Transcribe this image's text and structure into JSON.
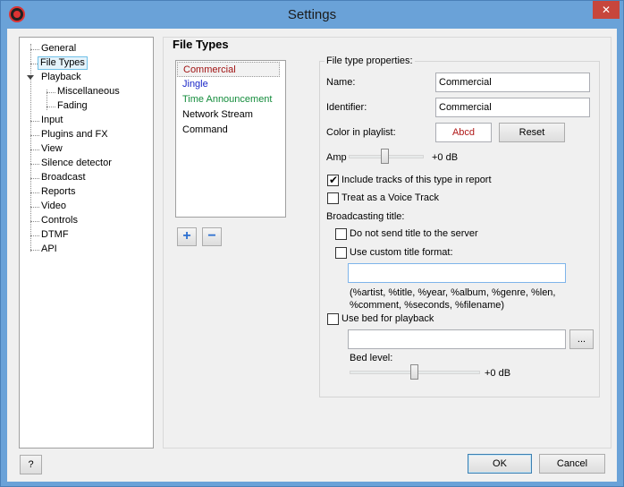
{
  "window": {
    "title": "Settings",
    "close_symbol": "✕"
  },
  "tree": {
    "items": [
      {
        "label": "General"
      },
      {
        "label": "File Types"
      },
      {
        "label": "Playback"
      },
      {
        "label": "Miscellaneous"
      },
      {
        "label": "Fading"
      },
      {
        "label": "Input"
      },
      {
        "label": "Plugins and FX"
      },
      {
        "label": "View"
      },
      {
        "label": "Silence detector"
      },
      {
        "label": "Broadcast"
      },
      {
        "label": "Reports"
      },
      {
        "label": "Video"
      },
      {
        "label": "Controls"
      },
      {
        "label": "DTMF"
      },
      {
        "label": "API"
      }
    ]
  },
  "panel": {
    "title": "File Types",
    "file_types": [
      {
        "label": "Commercial",
        "color": "#a01414"
      },
      {
        "label": "Jingle",
        "color": "#1c28c8"
      },
      {
        "label": "Time Announcement",
        "color": "#148c3c"
      },
      {
        "label": "Network Stream",
        "color": "#000000"
      },
      {
        "label": "Command",
        "color": "#000000"
      }
    ],
    "add_symbol": "+",
    "remove_symbol": "−"
  },
  "props": {
    "group_label": "File type properties:",
    "name_label": "Name:",
    "name_value": "Commercial",
    "identifier_label": "Identifier:",
    "identifier_value": "Commercial",
    "color_label": "Color in playlist:",
    "color_sample": "Abcd",
    "color_sample_hex": "#b01818",
    "reset_label": "Reset",
    "amp_label": "Amp",
    "amp_value": "+0 dB",
    "include_label": "Include tracks of this type in report",
    "include_checked": true,
    "voice_label": "Treat as a Voice Track",
    "voice_checked": false,
    "broadcast_title_label": "Broadcasting title:",
    "no_send_label": "Do not send title to the server",
    "no_send_checked": false,
    "custom_label": "Use custom title format:",
    "custom_checked": false,
    "custom_value": "",
    "format_hint": "(%artist, %title, %year, %album, %genre, %len, %comment, %seconds, %filename)",
    "bed_label": "Use bed for playback",
    "bed_checked": false,
    "bed_value": "",
    "browse_label": "...",
    "bed_level_label": "Bed level:",
    "bed_level_value": "+0 dB"
  },
  "footer": {
    "help_label": "?",
    "ok_label": "OK",
    "cancel_label": "Cancel"
  }
}
